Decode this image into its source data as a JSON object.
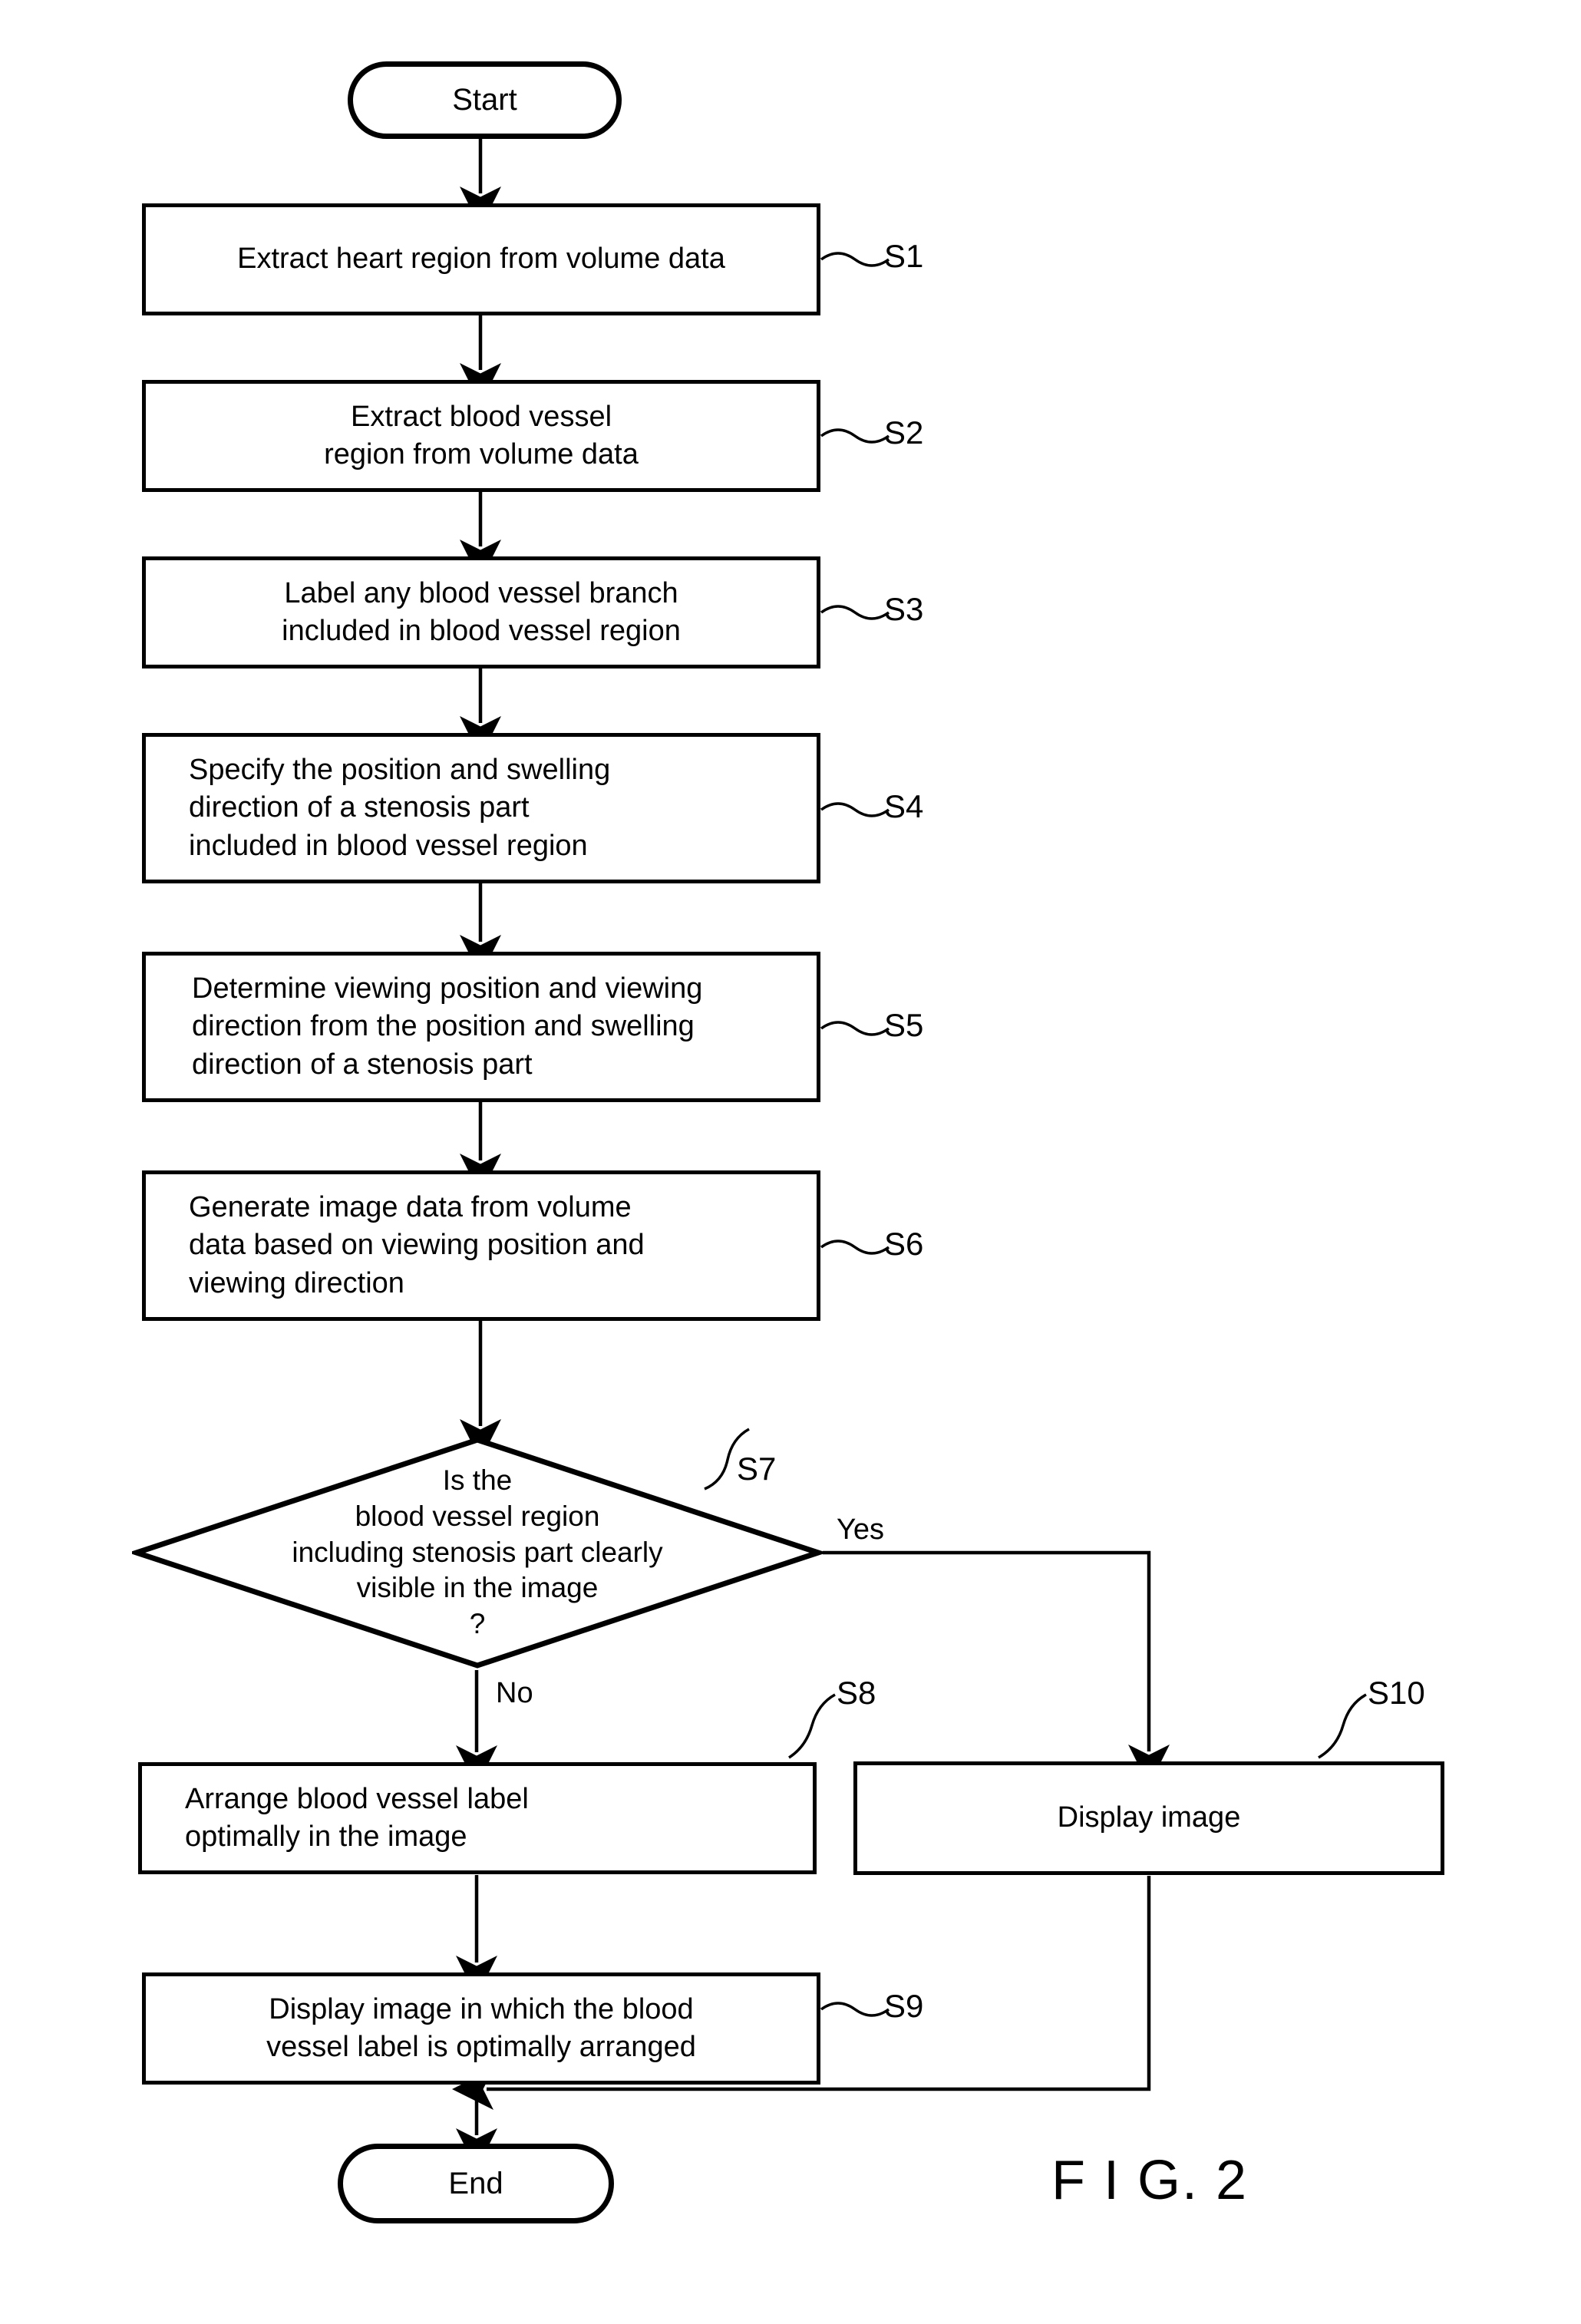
{
  "figure": {
    "label": "F I G. 2"
  },
  "terminators": {
    "start": "Start",
    "end": "End"
  },
  "edge_labels": {
    "yes": "Yes",
    "no": "No"
  },
  "decision": {
    "step_id": "S7",
    "lines": [
      "Is the",
      "blood vessel region",
      "including stenosis part clearly",
      "visible in the image",
      "?"
    ]
  },
  "steps": [
    {
      "id": "S1",
      "lines": [
        "Extract heart region from volume data"
      ]
    },
    {
      "id": "S2",
      "lines": [
        "Extract blood vessel",
        "region from volume data"
      ]
    },
    {
      "id": "S3",
      "lines": [
        "Label any blood vessel branch",
        "included in blood vessel region"
      ]
    },
    {
      "id": "S4",
      "lines": [
        "Specify the position and swelling",
        "direction of a stenosis part",
        "included in blood vessel region"
      ]
    },
    {
      "id": "S5",
      "lines": [
        "Determine viewing position and viewing",
        "direction from the  position and swelling",
        "direction of a stenosis part"
      ]
    },
    {
      "id": "S6",
      "lines": [
        "Generate image data from volume",
        "data based on viewing position and",
        "viewing direction"
      ]
    },
    {
      "id": "S8",
      "lines": [
        "Arrange blood vessel label",
        "optimally in the image"
      ]
    },
    {
      "id": "S9",
      "lines": [
        "Display image in which the blood",
        "vessel label is optimally arranged"
      ]
    },
    {
      "id": "S10",
      "lines": [
        "Display image"
      ]
    }
  ],
  "colors": {
    "stroke": "#000000",
    "background": "#ffffff"
  }
}
